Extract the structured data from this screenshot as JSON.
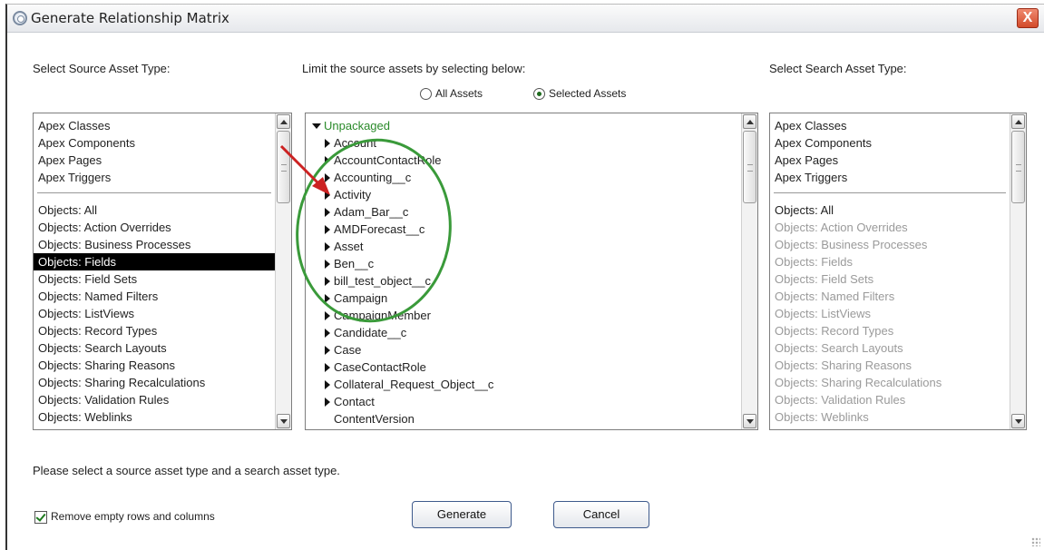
{
  "window": {
    "title": "Generate Relationship Matrix",
    "close_symbol": "X"
  },
  "labels": {
    "source_type": "Select Source Asset Type:",
    "limit": "Limit the source assets by selecting below:",
    "search_type": "Select Search Asset Type:"
  },
  "radios": {
    "all_assets": "All Assets",
    "selected_assets": "Selected Assets",
    "selected": "selected_assets"
  },
  "source_list": {
    "top_items": [
      "Apex Classes",
      "Apex Components",
      "Apex Pages",
      "Apex Triggers"
    ],
    "object_items": [
      "Objects: All",
      "Objects: Action Overrides",
      "Objects: Business Processes",
      "Objects: Fields",
      "Objects: Field Sets",
      "Objects: Named Filters",
      "Objects: ListViews",
      "Objects: Record Types",
      "Objects: Search Layouts",
      "Objects: Sharing Reasons",
      "Objects: Sharing Recalculations",
      "Objects: Validation Rules",
      "Objects: Weblinks"
    ],
    "selected": "Objects: Fields"
  },
  "tree": {
    "root": "Unpackaged",
    "nodes": [
      {
        "label": "Account",
        "expandable": true
      },
      {
        "label": "AccountContactRole",
        "expandable": true
      },
      {
        "label": "Accounting__c",
        "expandable": true
      },
      {
        "label": "Activity",
        "expandable": true
      },
      {
        "label": "Adam_Bar__c",
        "expandable": true
      },
      {
        "label": "AMDForecast__c",
        "expandable": true
      },
      {
        "label": "Asset",
        "expandable": true
      },
      {
        "label": "Ben__c",
        "expandable": true
      },
      {
        "label": "bill_test_object__c",
        "expandable": true
      },
      {
        "label": "Campaign",
        "expandable": true
      },
      {
        "label": "CampaignMember",
        "expandable": true
      },
      {
        "label": "Candidate__c",
        "expandable": true
      },
      {
        "label": "Case",
        "expandable": true
      },
      {
        "label": "CaseContactRole",
        "expandable": true
      },
      {
        "label": "Collateral_Request_Object__c",
        "expandable": true
      },
      {
        "label": "Contact",
        "expandable": true
      },
      {
        "label": "ContentVersion",
        "expandable": false
      }
    ]
  },
  "search_list": {
    "top_items": [
      "Apex Classes",
      "Apex Components",
      "Apex Pages",
      "Apex Triggers"
    ],
    "object_items": [
      "Objects: All",
      "Objects: Action Overrides",
      "Objects: Business Processes",
      "Objects: Fields",
      "Objects: Field Sets",
      "Objects: Named Filters",
      "Objects: ListViews",
      "Objects: Record Types",
      "Objects: Search Layouts",
      "Objects: Sharing Reasons",
      "Objects: Sharing Recalculations",
      "Objects: Validation Rules",
      "Objects: Weblinks"
    ],
    "enabled_count": 1
  },
  "status_message": "Please select a source asset type and a search asset type.",
  "remove_empty": {
    "label": "Remove empty rows and columns",
    "checked": true
  },
  "buttons": {
    "generate": "Generate",
    "cancel": "Cancel"
  },
  "colors": {
    "tree_root": "#2a8a2a",
    "annotation_circle": "#3a9a3a",
    "annotation_arrow": "#cc2222",
    "close_button": "#d24a2a"
  }
}
